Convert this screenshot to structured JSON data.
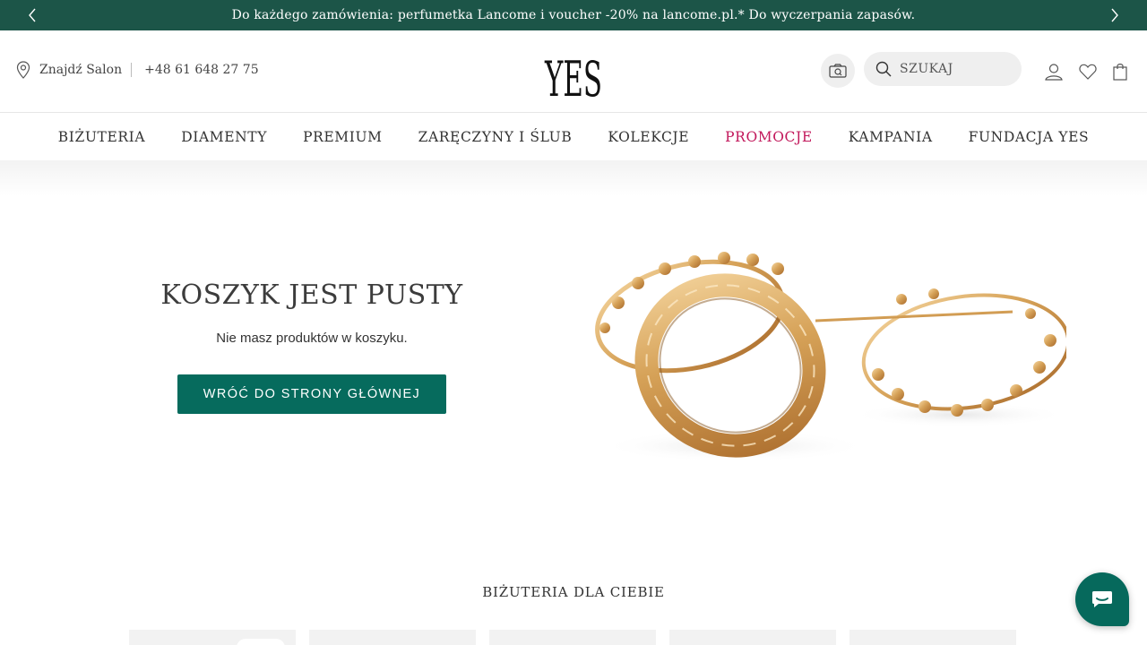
{
  "promo": {
    "text": "Do każdego zamówienia: perfumetka Lancome i voucher -20% na lancome.pl.* Do wyczerpania zapasów.",
    "prev_icon": "chevron-left-icon",
    "next_icon": "chevron-right-icon"
  },
  "header": {
    "salon_label": "Znajdź Salon",
    "phone": "+48 61 648 27 75",
    "logo_text": "YES",
    "search_placeholder": "SZUKAJ",
    "icons": [
      "camera-search-icon",
      "search-icon",
      "user-icon",
      "heart-icon",
      "bag-icon"
    ]
  },
  "nav": [
    {
      "label": "BIŻUTERIA"
    },
    {
      "label": "DIAMENTY"
    },
    {
      "label": "PREMIUM"
    },
    {
      "label": "ZARĘCZYNY I ŚLUB"
    },
    {
      "label": "KOLEKCJE"
    },
    {
      "label": "PROMOCJE"
    },
    {
      "label": "KAMPANIA"
    },
    {
      "label": "FUNDACJA YES"
    }
  ],
  "cart": {
    "title": "KOSZYK JEST PUSTY",
    "subtitle": "Nie masz produktów w koszyku.",
    "button": "WRÓĆ DO STRONY GŁÓWNEJ"
  },
  "recommendations": {
    "title": "BIŻUTERIA DLA CIEBIE"
  },
  "colors": {
    "promo_bar": "#1c5548",
    "accent": "#066b5d",
    "promo_link": "#c2185b"
  }
}
